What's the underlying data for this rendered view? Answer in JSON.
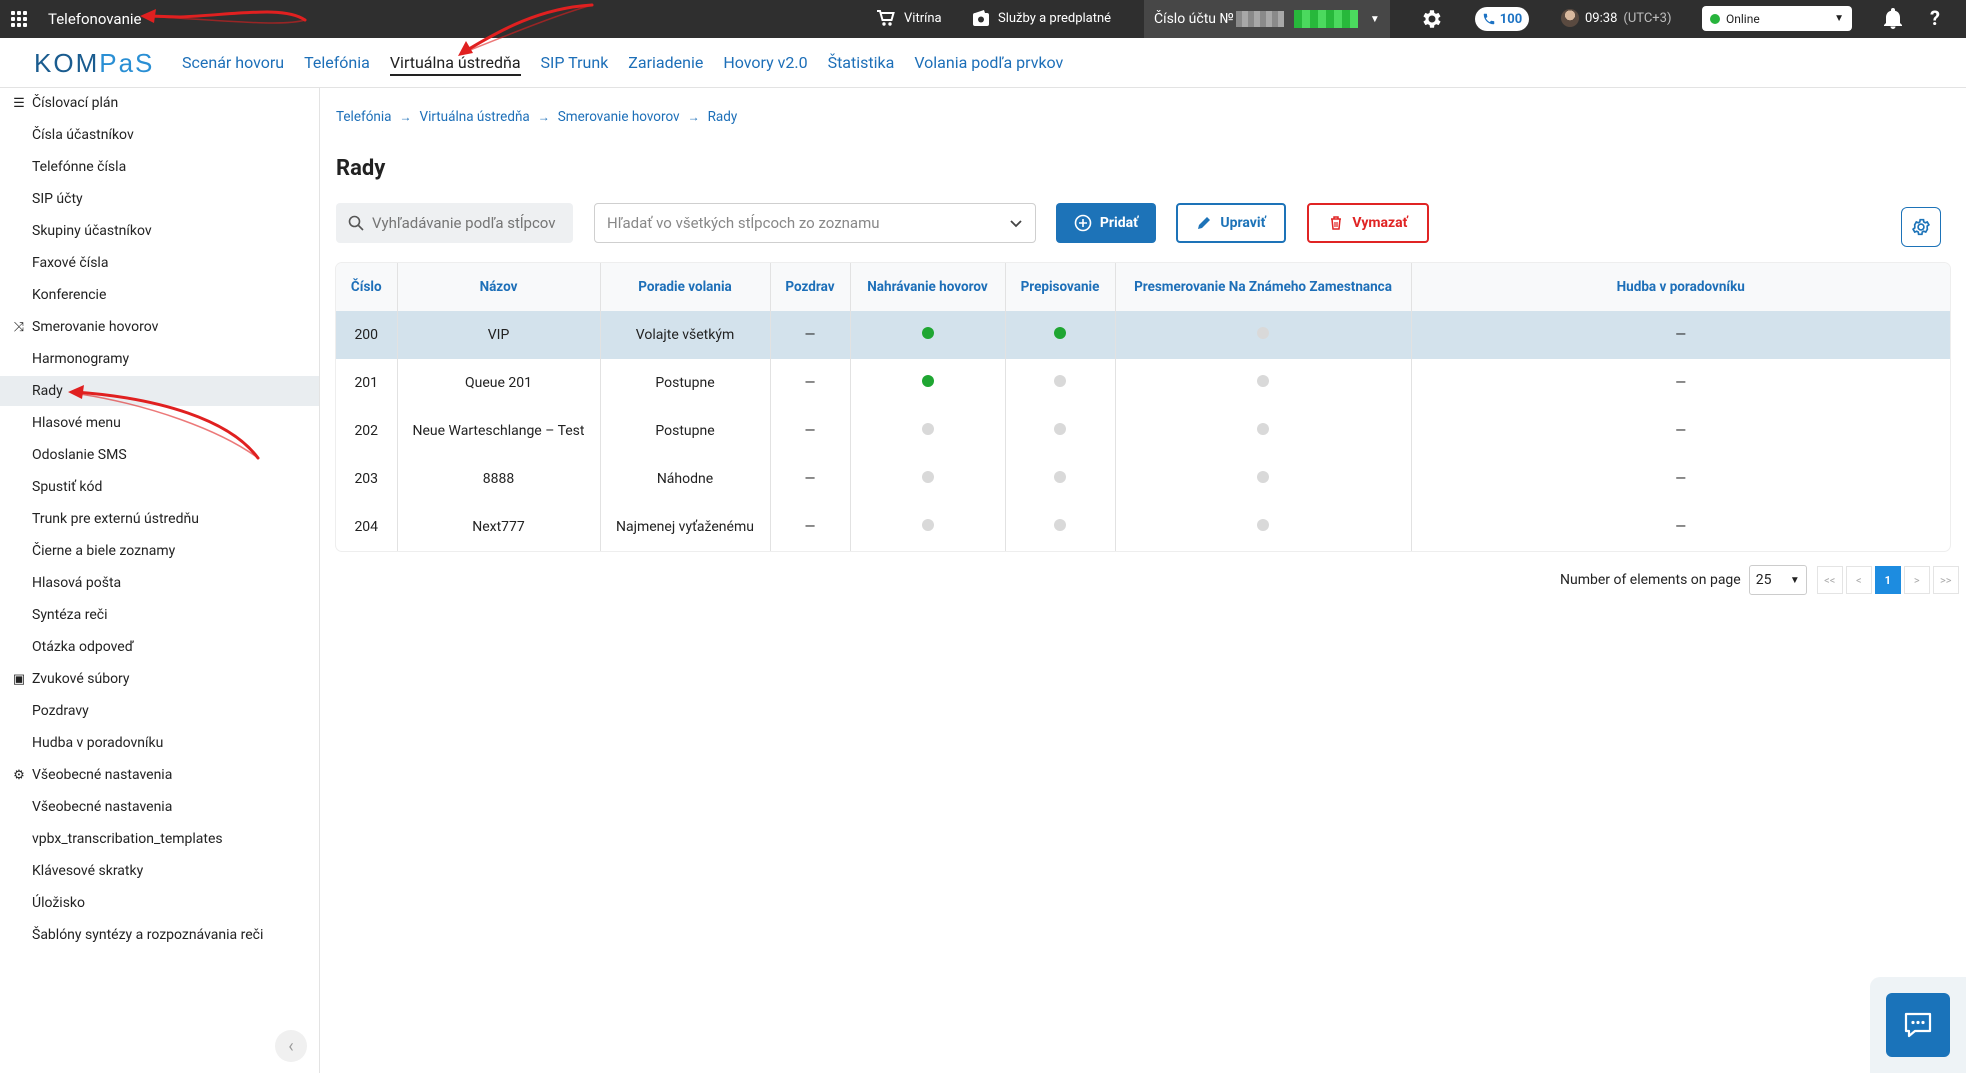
{
  "topbar": {
    "app_name": "Telefonovanie",
    "vitrina": "Vitrína",
    "sluzby": "Služby a predplatné",
    "account_label": "Číslo účtu №",
    "calls_count": "100",
    "time": "09:38",
    "timezone": "(UTC+3)",
    "status": "Online"
  },
  "nav": {
    "logo_a": "KOM",
    "logo_b": "PaS",
    "items": [
      "Scenár hovoru",
      "Telefónia",
      "Virtuálna ústredňa",
      "SIP Trunk",
      "Zariadenie",
      "Hovory v2.0",
      "Štatistika",
      "Volania podľa prvkov"
    ],
    "active": "Virtuálna ústredňa"
  },
  "sidebar": {
    "groups": [
      {
        "label": "Číslovací plán",
        "items": [
          "Čísla účastníkov",
          "Telefónne čísla",
          "SIP účty",
          "Skupiny účastníkov",
          "Faxové čísla",
          "Konferencie"
        ]
      },
      {
        "label": "Smerovanie hovorov",
        "items": [
          "Harmonogramy",
          "Rady",
          "Hlasové menu",
          "Odoslanie SMS",
          "Spustiť kód",
          "Trunk pre externú ústredňu",
          "Čierne a biele zoznamy",
          "Hlasová pošta",
          "Syntéza reči",
          "Otázka odpoveď"
        ]
      },
      {
        "label": "Zvukové súbory",
        "items": [
          "Pozdravy",
          "Hudba v poradovníku"
        ]
      },
      {
        "label": "Všeobecné nastavenia",
        "items": [
          "Všeobecné nastavenia",
          "vpbx_transcribation_templates",
          "Klávesové skratky",
          "Úložisko",
          "Šablóny syntézy a rozpoznávania reči"
        ]
      }
    ],
    "active_item": "Rady"
  },
  "breadcrumb": [
    "Telefónia",
    "Virtuálna ústredňa",
    "Smerovanie hovorov",
    "Rady"
  ],
  "page_title": "Rady",
  "toolbar": {
    "search_placeholder": "Vyhľadávanie podľa stĺpcov",
    "select_placeholder": "Hľadať vo všetkých stĺpcoch zo zoznamu",
    "add_label": "Pridať",
    "edit_label": "Upraviť",
    "delete_label": "Vymazať"
  },
  "table": {
    "columns": [
      "Číslo",
      "Názov",
      "Poradie volania",
      "Pozdrav",
      "Nahrávanie hovorov",
      "Prepisovanie",
      "Presmerovanie Na Známeho Zamestnanca",
      "Hudba v poradovníku"
    ],
    "rows": [
      {
        "cislo": "200",
        "nazov": "VIP",
        "poradie": "Volajte všetkým",
        "pozdrav": "—",
        "nahravanie": true,
        "prepisovanie": true,
        "presmerovanie": false,
        "hudba": "—",
        "selected": true
      },
      {
        "cislo": "201",
        "nazov": "Queue 201",
        "poradie": "Postupne",
        "pozdrav": "—",
        "nahravanie": true,
        "prepisovanie": false,
        "presmerovanie": false,
        "hudba": "—",
        "selected": false
      },
      {
        "cislo": "202",
        "nazov": "Neue Warteschlange – Test",
        "poradie": "Postupne",
        "pozdrav": "—",
        "nahravanie": false,
        "prepisovanie": false,
        "presmerovanie": false,
        "hudba": "—",
        "selected": false
      },
      {
        "cislo": "203",
        "nazov": "8888",
        "poradie": "Náhodne",
        "pozdrav": "—",
        "nahravanie": false,
        "prepisovanie": false,
        "presmerovanie": false,
        "hudba": "—",
        "selected": false
      },
      {
        "cislo": "204",
        "nazov": "Next777",
        "poradie": "Najmenej vyťaženému",
        "pozdrav": "—",
        "nahravanie": false,
        "prepisovanie": false,
        "presmerovanie": false,
        "hudba": "—",
        "selected": false
      }
    ]
  },
  "pagination": {
    "label": "Number of elements on page",
    "page_size": "25",
    "first": "<<",
    "prev": "<",
    "current": "1",
    "next": ">",
    "last": ">>"
  },
  "colors": {
    "topbar": "#2f2f2f",
    "accent": "#1d73b8",
    "danger": "#e02424",
    "selected_row": "#d3e2ec",
    "dot_on": "#1fa632",
    "dot_off": "#d9d9d9",
    "annotation_arrow": "#e02020"
  }
}
